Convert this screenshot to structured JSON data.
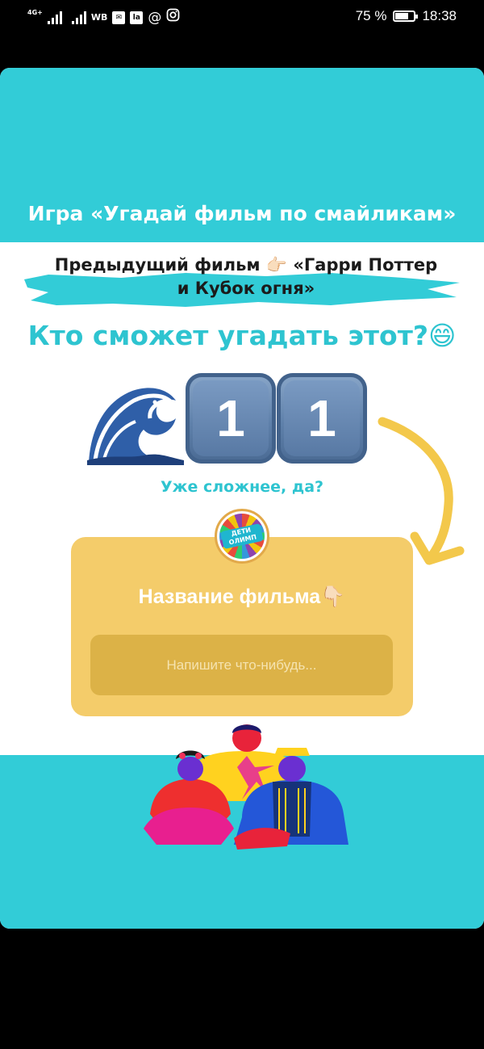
{
  "status_bar": {
    "network": "4G+",
    "carrier_label": "WB",
    "battery_percent": "75 %",
    "battery_level": 0.75,
    "time": "18:38",
    "icons": [
      "signal-icon",
      "signal-icon",
      "mail-icon",
      "la-app-icon",
      "at-icon",
      "instagram-icon",
      "battery-icon"
    ]
  },
  "story": {
    "title": "Игра «Угадай фильм по смайликам»",
    "previous_line1": "Предыдущий фильм 👉🏻 «Гарри Поттер",
    "previous_line2": "и Кубок огня»",
    "question": "Кто сможет угадать этот?😄",
    "emoji_puzzle": {
      "icons": [
        "wave-icon",
        "keycap-1-icon",
        "keycap-1-icon"
      ],
      "keycap_1": "1",
      "keycap_2": "1"
    },
    "hint": "Уже сложнее, да?",
    "logo_text_line1": "ДЕТИ",
    "logo_text_line2": "ОЛИМП",
    "question_box": {
      "title": "Название фильма👇🏻",
      "placeholder": "Напишите что-нибудь..."
    },
    "colors": {
      "band": "#32ccd7",
      "accent_text": "#2ec4d0",
      "box": "#f4cc6a",
      "arrow": "#f3c84b"
    }
  }
}
